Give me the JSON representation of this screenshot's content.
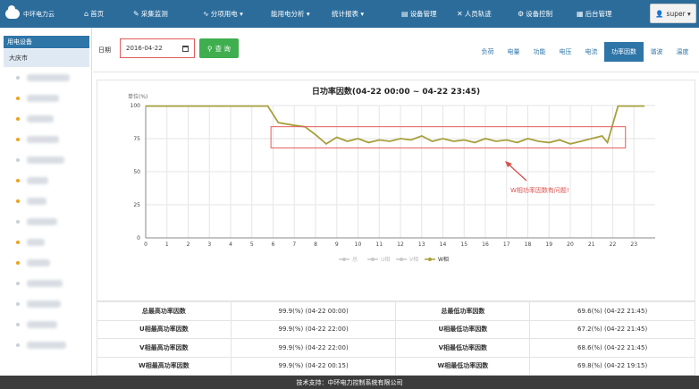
{
  "app": {
    "logo_text": "中环电力云"
  },
  "nav": [
    {
      "icon": "⌂",
      "label": "首页"
    },
    {
      "icon": "✎",
      "label": "采集监测"
    },
    {
      "icon": "∿",
      "label": "分项用电 ▾"
    },
    {
      "icon": "",
      "label": "能用电分析 ▾"
    },
    {
      "icon": "",
      "label": "统计报表 ▾"
    },
    {
      "icon": "▤",
      "label": "设备管理"
    },
    {
      "icon": "✕",
      "label": "人员轨迹"
    },
    {
      "icon": "⚙",
      "label": "设备控制"
    },
    {
      "icon": "▦",
      "label": "后台管理"
    }
  ],
  "user": {
    "icon": "👤",
    "label": "super ▾"
  },
  "sidebar": {
    "header": "用电设备",
    "root": "大庆市",
    "items": [
      {
        "dot": "#c8d0d8",
        "w": 48
      },
      {
        "dot": "#f0a020",
        "w": 36
      },
      {
        "dot": "#f0a020",
        "w": 30
      },
      {
        "dot": "#f0a020",
        "w": 36
      },
      {
        "dot": "#c8d0d8",
        "w": 42
      },
      {
        "dot": "#f0a020",
        "w": 24
      },
      {
        "dot": "#f0a020",
        "w": 22
      },
      {
        "dot": "#c8d0d8",
        "w": 34
      },
      {
        "dot": "#f0a020",
        "w": 20
      },
      {
        "dot": "#f0a020",
        "w": 26
      },
      {
        "dot": "#c8d0d8",
        "w": 40
      },
      {
        "dot": "#c8d0d8",
        "w": 38
      },
      {
        "dot": "#c8d0d8",
        "w": 34
      },
      {
        "dot": "#c8d0d8",
        "w": 44
      }
    ]
  },
  "filter": {
    "date_label": "日期",
    "date_value": "2016-04-22",
    "query_label": "查 询"
  },
  "tabs": [
    "负荷",
    "电量",
    "功能",
    "电压",
    "电流",
    "功率因数",
    "谐波",
    "温度"
  ],
  "active_tab": 5,
  "chart_data": {
    "type": "line",
    "title": "日功率因数(04-22 00:00 ~ 04-22 23:45)",
    "ylabel": "单位(%)",
    "ylim": [
      0,
      100
    ],
    "yticks": [
      0,
      25,
      50,
      75,
      100
    ],
    "xlim": [
      0,
      24
    ],
    "xticks": [
      0,
      1,
      2,
      3,
      4,
      5,
      6,
      7,
      8,
      9,
      10,
      11,
      12,
      13,
      14,
      15,
      16,
      17,
      18,
      19,
      20,
      21,
      22,
      23
    ],
    "grid": true,
    "legend": [
      "总",
      "U相",
      "V相",
      "W相"
    ],
    "legend_active": "W相",
    "series": [
      {
        "name": "W相",
        "color": "#a7a03c",
        "x": [
          0,
          5.75,
          6.25,
          7,
          7.5,
          8,
          8.5,
          9,
          9.5,
          10,
          10.5,
          11,
          11.5,
          12,
          12.5,
          13,
          13.5,
          14,
          14.5,
          15,
          15.5,
          16,
          16.5,
          17,
          17.5,
          18,
          18.5,
          19,
          19.5,
          20,
          20.5,
          21,
          21.5,
          21.75,
          22.25,
          23.5
        ],
        "y": [
          99.6,
          99.6,
          87,
          85,
          84,
          78,
          71,
          76,
          73,
          75,
          72,
          74,
          73,
          75,
          74,
          77,
          73,
          75,
          73,
          74,
          72,
          75,
          73,
          74,
          72,
          75,
          73,
          72,
          74,
          71,
          73,
          75,
          77,
          72,
          99.6,
          99.6
        ]
      }
    ],
    "annotation": "W相功率因数有问题!",
    "annotation_color": "#d9534f"
  },
  "summary": [
    [
      "总最高功率因数",
      "99.9(%) (04-22 00:00)",
      "总最低功率因数",
      "69.6(%) (04-22 21:45)"
    ],
    [
      "U相最高功率因数",
      "99.9(%) (04-22 22:00)",
      "U相最低功率因数",
      "67.2(%) (04-22 21:45)"
    ],
    [
      "V相最高功率因数",
      "99.9(%) (04-22 22:00)",
      "V相最低功率因数",
      "68.6(%) (04-22 21:45)"
    ],
    [
      "W相最高功率因数",
      "99.9(%) (04-22 00:15)",
      "W相最低功率因数",
      "69.8(%) (04-22 19:15)"
    ]
  ],
  "footer": "技术支持：中环电力控制系统有限公司"
}
